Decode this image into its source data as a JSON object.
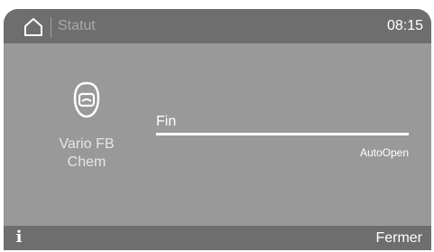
{
  "header": {
    "home_icon": "home-icon",
    "title": "Statut",
    "time": "08:15"
  },
  "program": {
    "icon": "mask-icon",
    "name": "Vario FB\nChem"
  },
  "progress": {
    "phase": "Fin",
    "percent": 100,
    "note": "AutoOpen"
  },
  "footer": {
    "info_icon": "info-icon",
    "info_glyph": "i",
    "close_label": "Fermer"
  },
  "colors": {
    "screen_bg": "#999999",
    "bar_bg": "#6e6e6e",
    "text": "#ffffff"
  }
}
